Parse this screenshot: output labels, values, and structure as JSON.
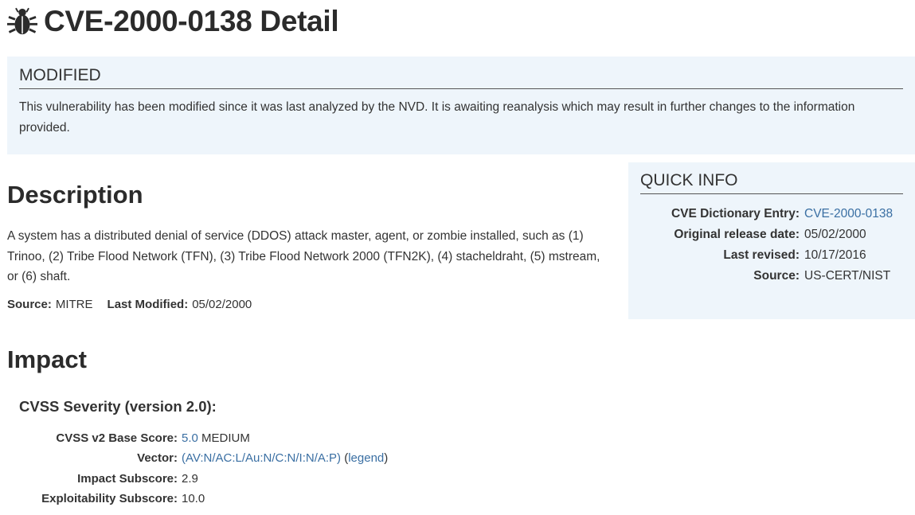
{
  "title": "CVE-2000-0138 Detail",
  "icon": "bug-icon",
  "alert": {
    "heading": "MODIFIED",
    "text": "This vulnerability has been modified since it was last analyzed by the NVD. It is awaiting reanalysis which may result in further changes to the information provided."
  },
  "description": {
    "heading": "Description",
    "text": "A system has a distributed denial of service (DDOS) attack master, agent, or zombie installed, such as (1) Trinoo, (2) Tribe Flood Network (TFN), (3) Tribe Flood Network 2000 (TFN2K), (4) stacheldraht, (5) mstream, or (6) shaft.",
    "source_label": "Source:",
    "source_value": "MITRE",
    "modified_label": "Last Modified:",
    "modified_value": "05/02/2000"
  },
  "quick_info": {
    "heading": "QUICK INFO",
    "rows": [
      {
        "label": "CVE Dictionary Entry:",
        "value": "CVE-2000-0138"
      },
      {
        "label": "Original release date:",
        "value": "05/02/2000"
      },
      {
        "label": "Last revised:",
        "value": "10/17/2016"
      },
      {
        "label": "Source:",
        "value": "US-CERT/NIST"
      }
    ]
  },
  "impact": {
    "heading": "Impact",
    "cvss_heading": "CVSS Severity (version 2.0):",
    "base_score_label": "CVSS v2 Base Score:",
    "base_score": "5.0",
    "severity": "MEDIUM",
    "vector_label": "Vector:",
    "vector": "(AV:N/AC:L/Au:N/C:N/I:N/A:P)",
    "legend_link": "legend",
    "impact_subscore_label": "Impact Subscore:",
    "impact_subscore": "2.9",
    "exploitability_label": "Exploitability Subscore:",
    "exploitability": "10.0"
  },
  "colors": {
    "link": "#3a6fa3",
    "panel_bg": "#eef5fb",
    "heading": "#2b2b2b"
  }
}
